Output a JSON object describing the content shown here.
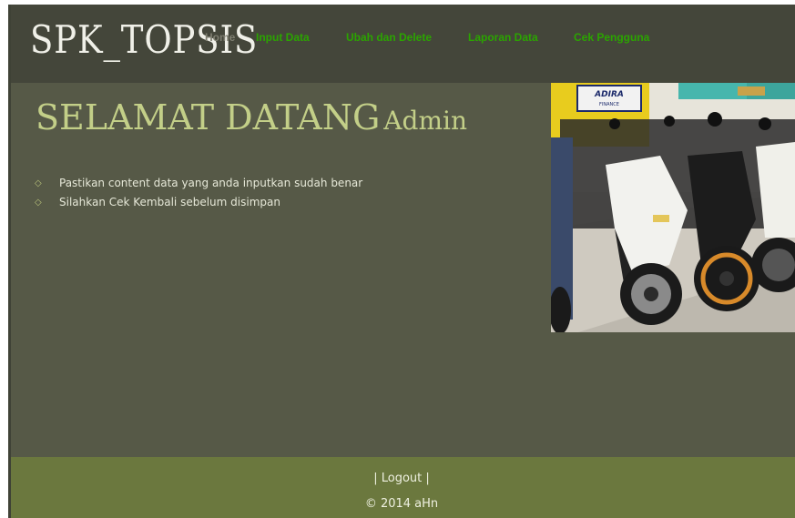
{
  "header": {
    "logo": "SPK_TOPSIS",
    "nav": [
      {
        "label": "Home",
        "active": true
      },
      {
        "label": "Input Data",
        "active": false
      },
      {
        "label": "Ubah dan Delete",
        "active": false
      },
      {
        "label": "Laporan Data",
        "active": false
      },
      {
        "label": "Cek Pengguna",
        "active": false
      }
    ]
  },
  "main": {
    "welcome_text": "SELAMAT DATANG",
    "welcome_user": "Admin",
    "notes": [
      "Pastikan content data yang anda inputkan sudah benar",
      "Silahkan Cek Kembali sebelum disimpan"
    ],
    "photo": {
      "sign_text": "ADIRA",
      "sign_sub": "FINANCE"
    }
  },
  "footer": {
    "logout_prefix": "| ",
    "logout_label": "Logout",
    "logout_suffix": " |",
    "copyright": "© 2014 aHn"
  },
  "colors": {
    "header_bg": "#44463a",
    "main_bg": "#565947",
    "footer_bg": "#6b783e",
    "nav_link": "#2ba400",
    "nav_active": "#7e7e70",
    "welcome": "#c3cf88"
  }
}
